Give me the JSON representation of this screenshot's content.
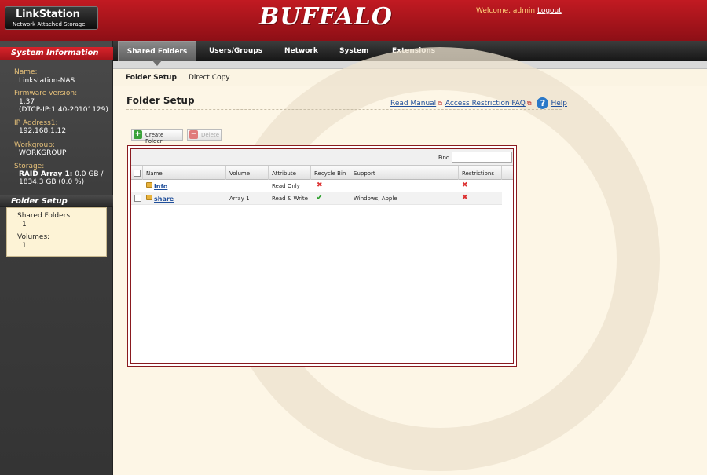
{
  "header": {
    "logo_title": "LinkStation",
    "logo_subtitle": "Network Attached Storage",
    "brand": "BUFFALO",
    "welcome": "Welcome, admin",
    "logout": "Logout"
  },
  "sidebar": {
    "system_info_title": "System Information",
    "name_label": "Name:",
    "name_value": "Linkstation-NAS",
    "firmware_label": "Firmware version:",
    "firmware_value": "1.37",
    "firmware_value2": "(DTCP-IP:1.40-20101129)",
    "ip_label": "IP Address1:",
    "ip_value": "192.168.1.12",
    "workgroup_label": "Workgroup:",
    "workgroup_value": "WORKGROUP",
    "storage_label": "Storage:",
    "storage_value_bold": "RAID Array 1:",
    "storage_value": " 0.0 GB /",
    "storage_value2": "1834.3 GB (0.0 %)",
    "folder_setup_title": "Folder Setup",
    "shared_folders_label": "Shared Folders:",
    "shared_folders_value": "1",
    "volumes_label": "Volumes:",
    "volumes_value": "1"
  },
  "nav": {
    "tabs": [
      "Shared Folders",
      "Users/Groups",
      "Network",
      "System",
      "Extensions"
    ],
    "subtabs": [
      "Folder Setup",
      "Direct Copy"
    ]
  },
  "main": {
    "title": "Folder Setup",
    "read_manual": "Read Manual",
    "access_faq": "Access Restriction FAQ",
    "help": "Help",
    "create_folder": "Create Folder",
    "delete": "Delete",
    "find_label": "Find",
    "find_value": ""
  },
  "table": {
    "columns": [
      "Name",
      "Volume",
      "Attribute",
      "Recycle Bin",
      "Support",
      "Restrictions"
    ],
    "rows": [
      {
        "name": "info",
        "volume": "",
        "attribute": "Read Only",
        "recycle_bin": "no",
        "support": "",
        "restrictions": "no"
      },
      {
        "name": "share",
        "volume": "Array 1",
        "attribute": "Read & Write",
        "recycle_bin": "yes",
        "support": "Windows, Apple",
        "restrictions": "no"
      }
    ]
  },
  "icons": {
    "check": "✔",
    "cross": "✖",
    "plus": "+",
    "minus": "−",
    "external": "⧉",
    "help": "?"
  },
  "colors": {
    "header_red": "#a5141b",
    "link_blue": "#1f4e9a",
    "accent_gold": "#e8c27a"
  }
}
